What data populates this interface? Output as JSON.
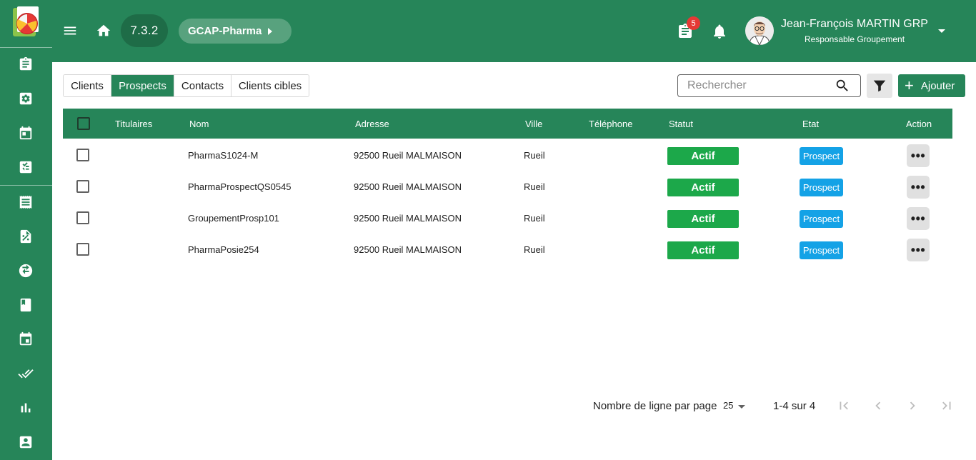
{
  "app": {
    "version": "7.3.2",
    "brand": "GCAP-Pharma",
    "notifications_count": "5",
    "user_name": "Jean-François MARTIN GRP",
    "user_role": "Responsable Groupement",
    "colors": {
      "primary": "#268559",
      "statut": "#1ca84a",
      "etat": "#14a2e6",
      "badge": "#e53935"
    }
  },
  "sidebar": {
    "items": [
      {
        "icon": "clipboard-icon"
      },
      {
        "icon": "settings-box-icon"
      },
      {
        "icon": "calendar-icon"
      },
      {
        "icon": "checklist-icon"
      },
      {
        "icon": "receipt-icon"
      },
      {
        "icon": "discount-document-icon"
      },
      {
        "icon": "exchange-icon"
      },
      {
        "icon": "book-icon"
      },
      {
        "icon": "calendar-event-icon"
      },
      {
        "icon": "double-check-icon"
      },
      {
        "icon": "bar-chart-icon"
      },
      {
        "icon": "contact-card-icon"
      }
    ]
  },
  "tabs": [
    {
      "label": "Clients",
      "active": false
    },
    {
      "label": "Prospects",
      "active": true
    },
    {
      "label": "Contacts",
      "active": false
    },
    {
      "label": "Clients cibles",
      "active": false
    }
  ],
  "search": {
    "placeholder": "Rechercher",
    "value": ""
  },
  "actions": {
    "add_label": "Ajouter"
  },
  "table": {
    "headers": {
      "titulaires": "Titulaires",
      "nom": "Nom",
      "adresse": "Adresse",
      "ville": "Ville",
      "telephone": "Téléphone",
      "statut": "Statut",
      "etat": "Etat",
      "action": "Action"
    },
    "rows": [
      {
        "titulaires": "",
        "nom": "PharmaS1024-M",
        "adresse": "92500 Rueil MALMAISON",
        "ville": "Rueil",
        "telephone": "",
        "statut": "Actif",
        "etat": "Prospect"
      },
      {
        "titulaires": "",
        "nom": "PharmaProspectQS0545",
        "adresse": "92500 Rueil MALMAISON",
        "ville": "Rueil",
        "telephone": "",
        "statut": "Actif",
        "etat": "Prospect"
      },
      {
        "titulaires": "",
        "nom": "GroupementProsp101",
        "adresse": "92500 Rueil MALMAISON",
        "ville": "Rueil",
        "telephone": "",
        "statut": "Actif",
        "etat": "Prospect"
      },
      {
        "titulaires": "",
        "nom": "PharmaPosie254",
        "adresse": "92500 Rueil MALMAISON",
        "ville": "Rueil",
        "telephone": "",
        "statut": "Actif",
        "etat": "Prospect"
      }
    ]
  },
  "pagination": {
    "rows_per_page_label": "Nombre de ligne par page",
    "rows_per_page": "25",
    "range": "1-4 sur 4"
  }
}
